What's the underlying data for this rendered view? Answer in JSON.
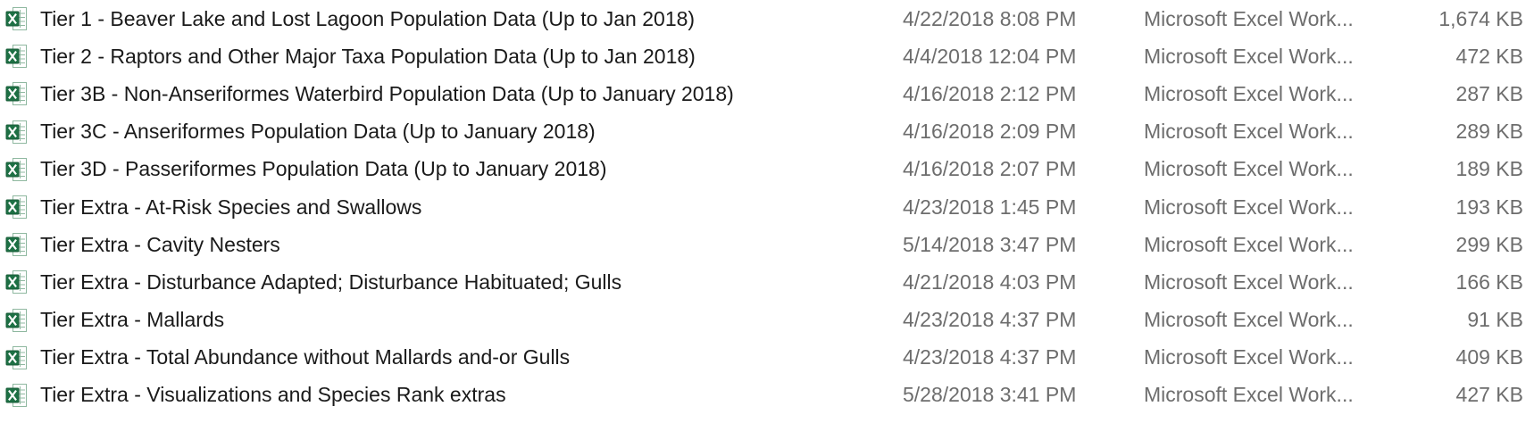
{
  "files": [
    {
      "name": "Tier 1 - Beaver Lake and Lost Lagoon Population Data (Up to Jan 2018)",
      "date": "4/22/2018 8:08 PM",
      "type": "Microsoft Excel Work...",
      "size": "1,674 KB",
      "icon": "excel-file-icon"
    },
    {
      "name": "Tier 2 - Raptors and Other Major Taxa Population Data (Up to Jan 2018)",
      "date": "4/4/2018 12:04 PM",
      "type": "Microsoft Excel Work...",
      "size": "472 KB",
      "icon": "excel-file-icon"
    },
    {
      "name": "Tier 3B - Non-Anseriformes Waterbird Population Data (Up to January 2018)",
      "date": "4/16/2018 2:12 PM",
      "type": "Microsoft Excel Work...",
      "size": "287 KB",
      "icon": "excel-file-icon"
    },
    {
      "name": "Tier 3C - Anseriformes Population Data (Up to January 2018)",
      "date": "4/16/2018 2:09 PM",
      "type": "Microsoft Excel Work...",
      "size": "289 KB",
      "icon": "excel-file-icon"
    },
    {
      "name": "Tier 3D - Passeriformes Population Data (Up to January 2018)",
      "date": "4/16/2018 2:07 PM",
      "type": "Microsoft Excel Work...",
      "size": "189 KB",
      "icon": "excel-file-icon"
    },
    {
      "name": "Tier Extra - At-Risk Species and Swallows",
      "date": "4/23/2018 1:45 PM",
      "type": "Microsoft Excel Work...",
      "size": "193 KB",
      "icon": "excel-file-icon"
    },
    {
      "name": "Tier Extra - Cavity Nesters",
      "date": "5/14/2018 3:47 PM",
      "type": "Microsoft Excel Work...",
      "size": "299 KB",
      "icon": "excel-file-icon"
    },
    {
      "name": "Tier Extra - Disturbance Adapted; Disturbance Habituated; Gulls",
      "date": "4/21/2018 4:03 PM",
      "type": "Microsoft Excel Work...",
      "size": "166 KB",
      "icon": "excel-file-icon"
    },
    {
      "name": "Tier Extra - Mallards",
      "date": "4/23/2018 4:37 PM",
      "type": "Microsoft Excel Work...",
      "size": "91 KB",
      "icon": "excel-file-icon"
    },
    {
      "name": "Tier Extra - Total Abundance without Mallards and-or Gulls",
      "date": "4/23/2018 4:37 PM",
      "type": "Microsoft Excel Work...",
      "size": "409 KB",
      "icon": "excel-file-icon"
    },
    {
      "name": "Tier Extra - Visualizations and Species Rank extras",
      "date": "5/28/2018 3:41 PM",
      "type": "Microsoft Excel Work...",
      "size": "427 KB",
      "icon": "excel-file-icon"
    }
  ],
  "colors": {
    "excel_green": "#1d7044",
    "excel_dark": "#185c37",
    "sheet_bg": "#ffffff",
    "grid_line": "#8fb8a0",
    "secondary_text": "#6d6d6d"
  }
}
